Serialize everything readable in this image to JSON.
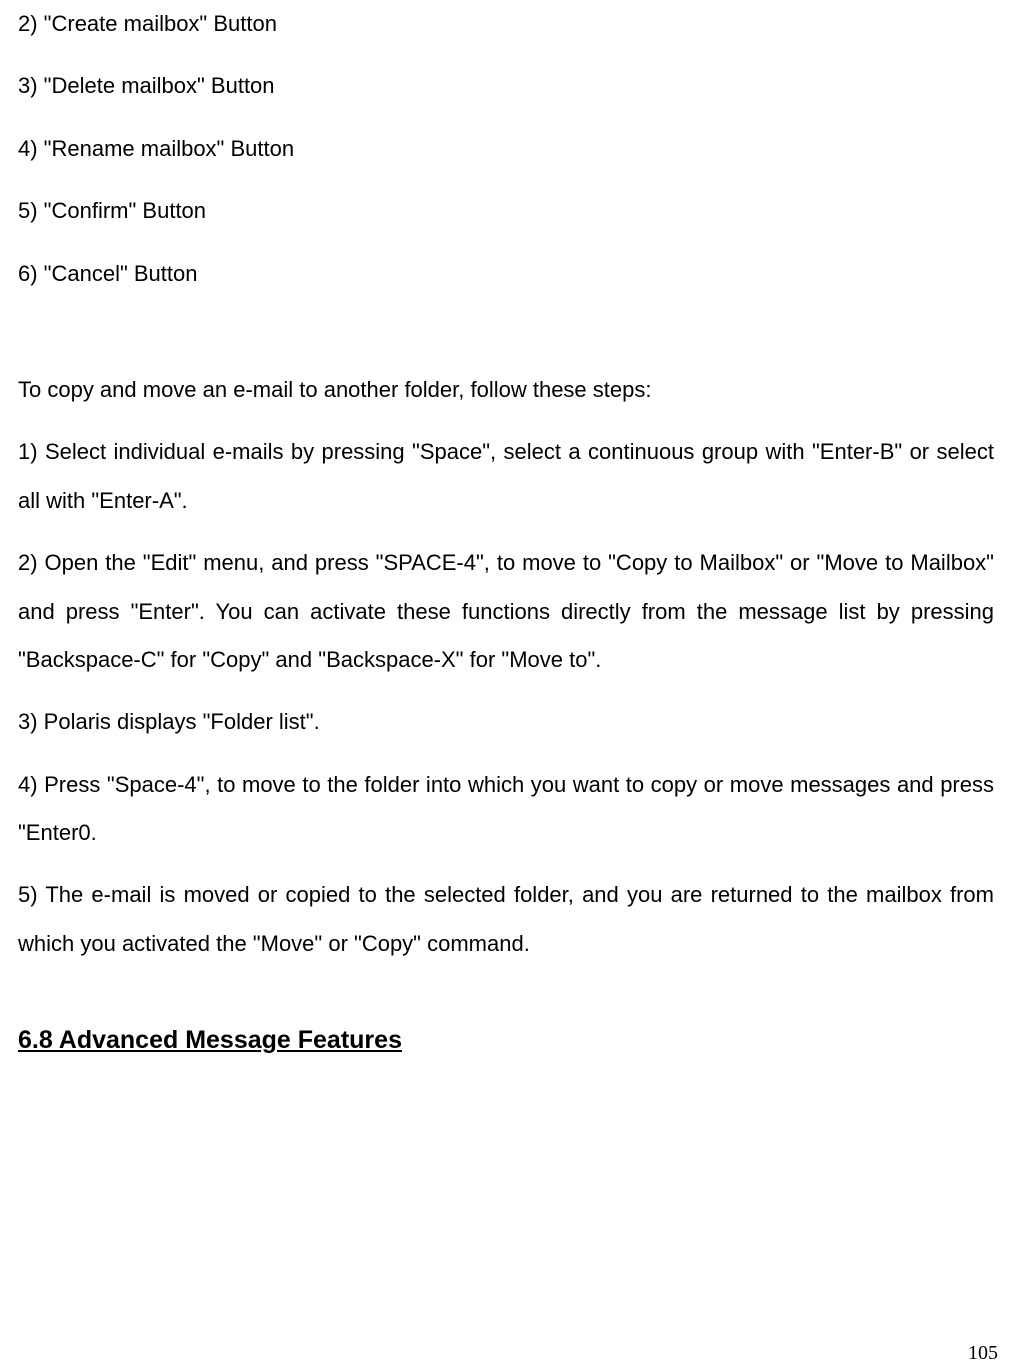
{
  "buttons": {
    "b2": "2) \"Create mailbox\" Button",
    "b3": "3) \"Delete mailbox\" Button",
    "b4": "4) \"Rename mailbox\" Button",
    "b5": "5) \"Confirm\" Button",
    "b6": "6) \"Cancel\" Button"
  },
  "intro": "To copy and move an e-mail to another folder, follow these steps:",
  "steps": {
    "s1": "1) Select individual e-mails by pressing \"Space\", select a continuous group with \"Enter-B\" or select all with \"Enter-A\".",
    "s2": "2) Open the \"Edit\" menu, and press \"SPACE-4\", to move to \"Copy to Mailbox\" or \"Move to Mailbox\" and press \"Enter\". You can activate these functions directly from the message list by pressing \"Backspace-C\" for \"Copy\" and \"Backspace-X\" for \"Move to\".",
    "s3": "3) Polaris displays \"Folder list\".",
    "s4": "4) Press \"Space-4\", to move to the folder into which you want to copy or move messages and press \"Enter0.",
    "s5": "5) The e-mail is moved or copied to the selected folder, and you are returned to the mailbox from which you activated the \"Move\" or \"Copy\" command."
  },
  "heading": "6.8 Advanced Message Features",
  "page_number": "105"
}
